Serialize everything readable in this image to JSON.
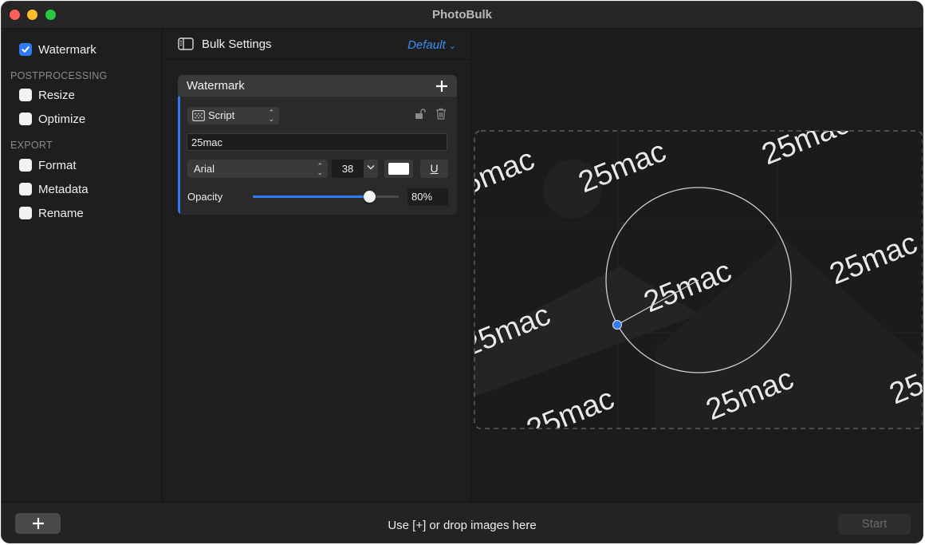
{
  "window": {
    "title": "PhotoBulk"
  },
  "sidebar": {
    "watermark": {
      "label": "Watermark",
      "checked": true
    },
    "postprocessing_header": "POSTPROCESSING",
    "postprocessing": [
      {
        "label": "Resize",
        "checked": false
      },
      {
        "label": "Optimize",
        "checked": false
      }
    ],
    "export_header": "EXPORT",
    "export": [
      {
        "label": "Format",
        "checked": false
      },
      {
        "label": "Metadata",
        "checked": false
      },
      {
        "label": "Rename",
        "checked": false
      }
    ]
  },
  "settings": {
    "title": "Bulk Settings",
    "preset": "Default",
    "card": {
      "title": "Watermark",
      "type": "Script",
      "text_value": "25mac",
      "font": "Arial",
      "size": "38",
      "color": "#ffffff",
      "underline_label": "U",
      "opacity_label": "Opacity",
      "opacity_value": "80%",
      "opacity_fraction": 0.8
    }
  },
  "preview": {
    "watermark_text": "25mac"
  },
  "bottom": {
    "add_label": "+",
    "hint": "Use [+] or drop images here",
    "start_label": "Start"
  },
  "colors": {
    "accent": "#2f7bf5",
    "preset_link": "#3a8ef6"
  }
}
